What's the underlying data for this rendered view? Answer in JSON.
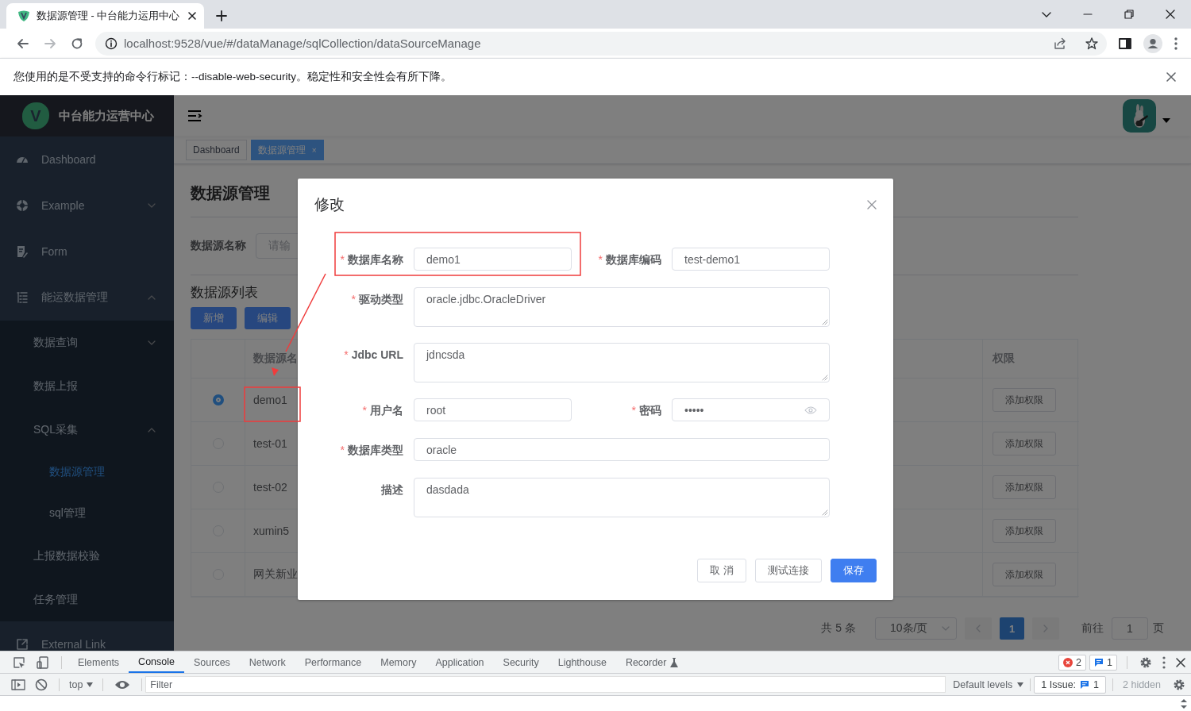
{
  "browser": {
    "tab_title": "数据源管理 - 中台能力运用中心",
    "address": "localhost:9528/vue/#/dataManage/sqlCollection/dataSourceManage",
    "infobar": "您使用的是不受支持的命令行标记：--disable-web-security。稳定性和安全性会有所下降。"
  },
  "sidebar": {
    "logo_letter": "V",
    "title": "中台能力运营中心",
    "items": [
      {
        "label": "Dashboard",
        "kind": "link",
        "selected": false
      },
      {
        "label": "Example",
        "kind": "submenu",
        "expanded": false,
        "selected": false
      },
      {
        "label": "Form",
        "kind": "link",
        "selected": false
      },
      {
        "label": "能运数据管理",
        "kind": "submenu",
        "expanded": true,
        "selected": false,
        "children": [
          {
            "label": "数据查询",
            "kind": "submenu",
            "expanded": false,
            "selected": false
          },
          {
            "label": "数据上报",
            "kind": "link",
            "selected": false
          },
          {
            "label": "SQL采集",
            "kind": "submenu",
            "expanded": true,
            "selected": false,
            "children": [
              {
                "label": "数据源管理",
                "kind": "link",
                "selected": true
              },
              {
                "label": "sql管理",
                "kind": "link",
                "selected": false
              }
            ]
          },
          {
            "label": "上报数据校验",
            "kind": "link",
            "selected": false
          },
          {
            "label": "任务管理",
            "kind": "link",
            "selected": false
          }
        ]
      },
      {
        "label": "External Link",
        "kind": "link",
        "selected": false
      }
    ]
  },
  "tags": [
    {
      "label": "Dashboard",
      "selected": false
    },
    {
      "label": "数据源管理",
      "selected": true,
      "close": "×"
    }
  ],
  "page": {
    "title": "数据源管理",
    "search": {
      "label": "数据源名称",
      "placeholder": "请输"
    },
    "list_title": "数据源列表",
    "buttons": [
      {
        "label": "新增"
      },
      {
        "label": "编辑"
      }
    ],
    "table": {
      "columns": {
        "name": "数据源名",
        "permission": "权限"
      },
      "rows": [
        {
          "selected": true,
          "name": "demo1",
          "action": "添加权限"
        },
        {
          "selected": false,
          "name": "test-01",
          "action": "添加权限"
        },
        {
          "selected": false,
          "name": "test-02",
          "action": "添加权限"
        },
        {
          "selected": false,
          "name": "xumin5",
          "action": "添加权限"
        },
        {
          "selected": false,
          "name": "网关新业",
          "action": "添加权限"
        }
      ]
    },
    "pagination": {
      "total": "共 5 条",
      "page_size": "10条/页",
      "pages": [
        {
          "label": "1",
          "selected": true
        }
      ],
      "goto_label": "前往",
      "goto_value": "1",
      "goto_suffix": "页"
    }
  },
  "dialog": {
    "title": "修改",
    "required_mark": "*",
    "rows": [
      [
        {
          "label": "数据库名称",
          "required": true,
          "kind": "input",
          "value": "demo1"
        },
        {
          "label": "数据库编码",
          "required": true,
          "kind": "input",
          "value": "test-demo1"
        }
      ],
      [
        {
          "label": "驱动类型",
          "required": true,
          "kind": "textarea",
          "value": "oracle.jdbc.OracleDriver"
        }
      ],
      [
        {
          "label": "Jdbc URL",
          "required": true,
          "kind": "textarea",
          "value": "jdncsda"
        }
      ],
      [
        {
          "label": "用户名",
          "required": true,
          "kind": "input",
          "value": "root"
        },
        {
          "label": "密码",
          "required": true,
          "kind": "password",
          "value": "•••••"
        }
      ],
      [
        {
          "label": "数据库类型",
          "required": true,
          "kind": "input",
          "value": "oracle"
        }
      ],
      [
        {
          "label": "描述",
          "required": false,
          "kind": "textarea",
          "value": "dasdada"
        }
      ]
    ],
    "buttons": [
      {
        "label": "取 消",
        "kind": "default"
      },
      {
        "label": "测试连接",
        "kind": "default"
      },
      {
        "label": "保存",
        "kind": "primary"
      }
    ]
  },
  "annotations": [
    {
      "kind": "box"
    },
    {
      "kind": "box"
    },
    {
      "kind": "arrow"
    }
  ],
  "devtools": {
    "tabs": [
      {
        "label": "Elements",
        "selected": false
      },
      {
        "label": "Console",
        "selected": true
      },
      {
        "label": "Sources",
        "selected": false
      },
      {
        "label": "Network",
        "selected": false
      },
      {
        "label": "Performance",
        "selected": false
      },
      {
        "label": "Memory",
        "selected": false
      },
      {
        "label": "Application",
        "selected": false
      },
      {
        "label": "Security",
        "selected": false
      },
      {
        "label": "Lighthouse",
        "selected": false
      },
      {
        "label": "Recorder",
        "selected": false
      }
    ],
    "errors": "2",
    "messages": "1",
    "context": "top",
    "filter_placeholder": "Filter",
    "levels": "Default levels",
    "issues_label": "1 Issue:",
    "issues_count": "1",
    "hidden": "2 hidden"
  }
}
